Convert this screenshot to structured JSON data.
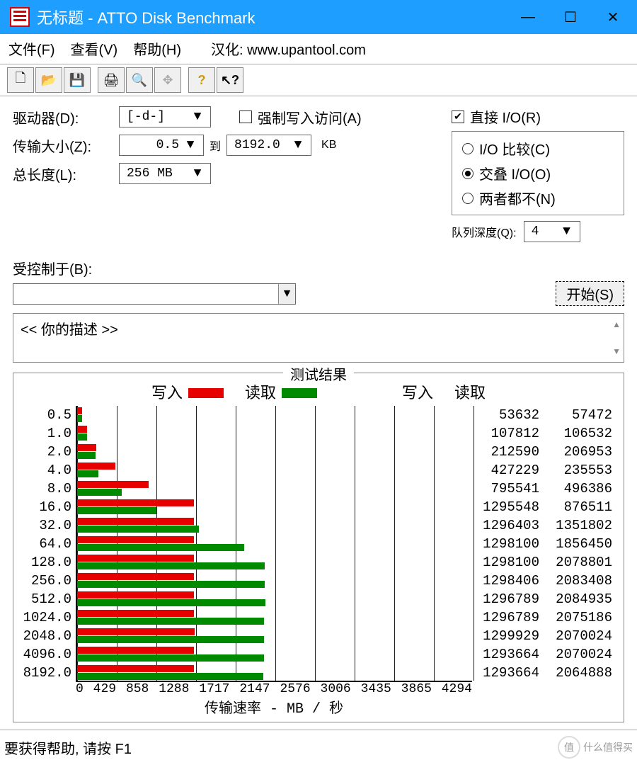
{
  "window": {
    "title": "无标题 - ATTO Disk Benchmark"
  },
  "menu": {
    "file": "文件(F)",
    "view": "查看(V)",
    "help": "帮助(H)",
    "credit": "汉化: www.upantool.com"
  },
  "labels": {
    "drive": "驱动器(D):",
    "transfer_size": "传输大小(Z):",
    "to": "到",
    "kb": "KB",
    "total_length": "总长度(L):",
    "force_write": "强制写入访问(A)",
    "direct_io": "直接 I/O(R)",
    "io_compare": "I/O 比较(C)",
    "overlapped": "交叠 I/O(O)",
    "neither": "两者都不(N)",
    "queue_depth": "队列深度(Q):",
    "controlled_by": "受控制于(B):",
    "start": "开始(S)",
    "description": "<<  你的描述   >>",
    "results_title": "测试结果",
    "write": "写入",
    "read": "读取",
    "xaxis": "传输速率 - MB / 秒",
    "status": "要获得帮助, 请按 F1",
    "watermark": "什么值得买"
  },
  "values": {
    "drive": "[-d-]",
    "size_from": "0.5",
    "size_to": "8192.0",
    "total_length": "256 MB",
    "force_write_checked": false,
    "direct_io_checked": true,
    "io_mode": "overlapped",
    "queue_depth": "4"
  },
  "chart_data": {
    "type": "bar",
    "title": "测试结果",
    "xlabel": "传输速率 - MB / 秒",
    "xlim": [
      0,
      4294
    ],
    "xticks": [
      0,
      429,
      858,
      1288,
      1717,
      2147,
      2576,
      3006,
      3435,
      3865,
      4294
    ],
    "categories": [
      "0.5",
      "1.0",
      "2.0",
      "4.0",
      "8.0",
      "16.0",
      "32.0",
      "64.0",
      "128.0",
      "256.0",
      "512.0",
      "1024.0",
      "2048.0",
      "4096.0",
      "8192.0"
    ],
    "series": [
      {
        "name": "写入",
        "color": "#E60000",
        "values_kb_s": [
          53632,
          107812,
          212590,
          427229,
          795541,
          1295548,
          1296403,
          1298100,
          1298100,
          1298406,
          1296789,
          1296789,
          1299929,
          1293664,
          1293664
        ]
      },
      {
        "name": "读取",
        "color": "#008A00",
        "values_kb_s": [
          57472,
          106532,
          206953,
          235553,
          496386,
          876511,
          1351802,
          1856450,
          2078801,
          2083408,
          2084935,
          2075186,
          2070024,
          2070024,
          2064888
        ]
      }
    ]
  }
}
